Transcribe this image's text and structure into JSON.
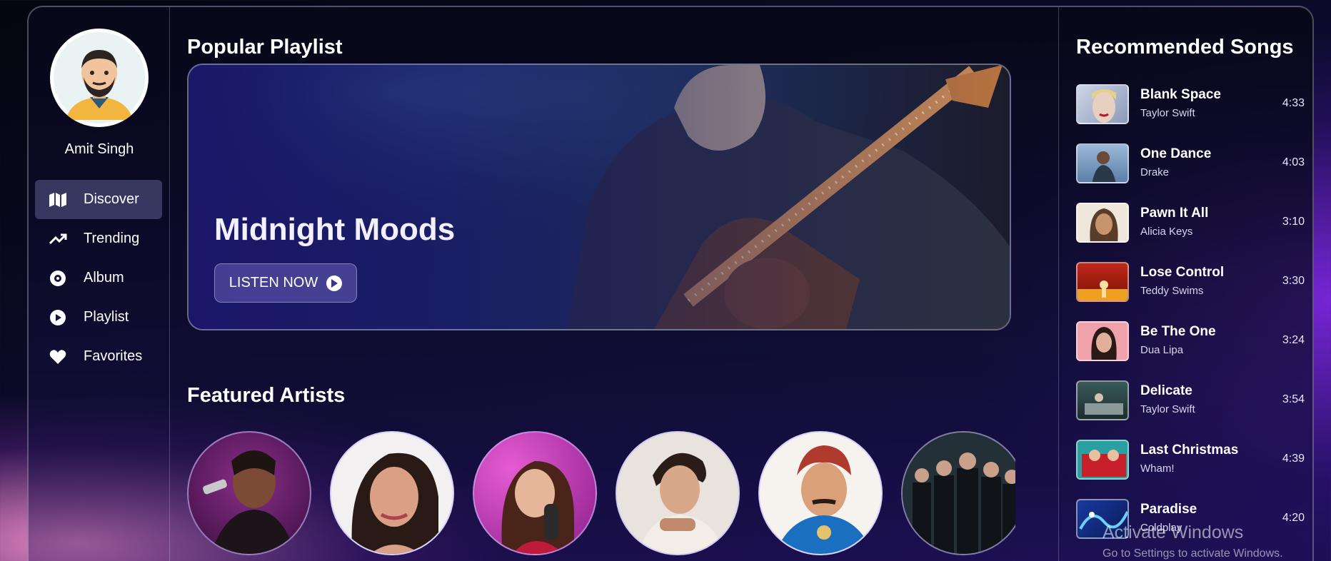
{
  "user": {
    "name": "Amit Singh"
  },
  "sidebar": {
    "items": [
      {
        "label": "Discover",
        "icon": "map-icon",
        "active": true
      },
      {
        "label": "Trending",
        "icon": "trending-icon",
        "active": false
      },
      {
        "label": "Album",
        "icon": "disc-icon",
        "active": false
      },
      {
        "label": "Playlist",
        "icon": "play-circle-icon",
        "active": false
      },
      {
        "label": "Favorites",
        "icon": "heart-icon",
        "active": false
      }
    ]
  },
  "main": {
    "popular_title": "Popular Playlist",
    "banner": {
      "title": "Midnight Moods",
      "button_label": "LISTEN NOW"
    },
    "featured_title": "Featured Artists"
  },
  "recommended": {
    "title": "Recommended Songs",
    "songs": [
      {
        "title": "Blank Space",
        "artist": "Taylor Swift",
        "duration": "4:33"
      },
      {
        "title": "One Dance",
        "artist": "Drake",
        "duration": "4:03"
      },
      {
        "title": "Pawn It All",
        "artist": "Alicia Keys",
        "duration": "3:10"
      },
      {
        "title": "Lose Control",
        "artist": "Teddy Swims",
        "duration": "3:30"
      },
      {
        "title": "Be The One",
        "artist": "Dua Lipa",
        "duration": "3:24"
      },
      {
        "title": "Delicate",
        "artist": "Taylor Swift",
        "duration": "3:54"
      },
      {
        "title": "Last Christmas",
        "artist": "Wham!",
        "duration": "4:39"
      },
      {
        "title": "Paradise",
        "artist": "Coldplay",
        "duration": "4:20"
      }
    ]
  },
  "watermark": {
    "line1": "Activate Windows",
    "line2": "Go to Settings to activate Windows."
  }
}
